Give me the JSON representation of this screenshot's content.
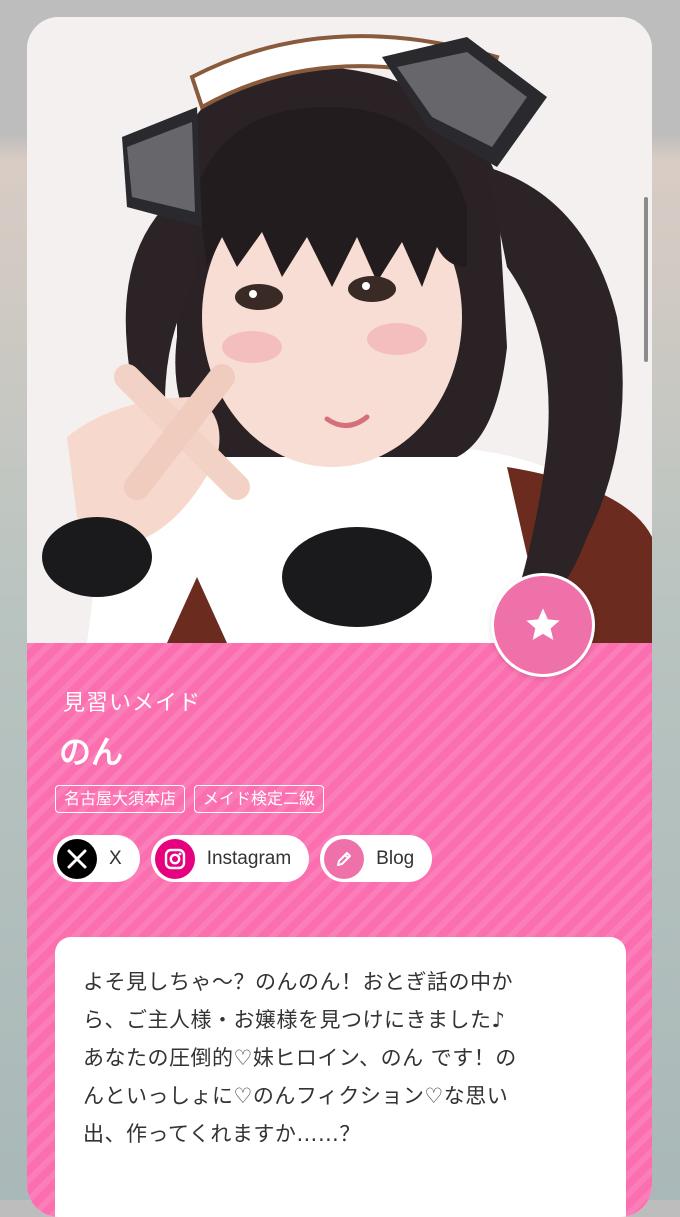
{
  "profile": {
    "rank": "見習いメイド",
    "name": "のん",
    "tags": [
      "名古屋大須本店",
      "メイド検定二級"
    ],
    "bio": "よそ見しちゃ〜？のんのん！おとぎ話の中から、ご主人様・お嬢様を見つけにきました♪あなたの圧倒的♡妹ヒロイン、のん です！のんといっしょに♡のんフィクション♡な思い出、作ってくれますか……？",
    "bio_lines": [
      "よそ見しちゃ〜？のんのん！おとぎ話の中か",
      "ら、ご主人様・お嬢様を見つけにきました♪",
      "あなたの圧倒的♡妹ヒロイン、のん です！の",
      "んといっしょに♡のんフィクション♡な思い",
      "出、作ってくれますか……？"
    ]
  },
  "socials": [
    {
      "label": "X",
      "icon": "x-logo-icon",
      "color": "#000000"
    },
    {
      "label": "Instagram",
      "icon": "instagram-icon",
      "color": "#e6007e"
    },
    {
      "label": "Blog",
      "icon": "pencil-icon",
      "color": "#ef71aa"
    }
  ],
  "favorite": {
    "icon": "star-icon"
  },
  "colors": {
    "accent_pink": "#fb6fb0",
    "button_pink": "#ef71aa",
    "text": "#333333"
  }
}
